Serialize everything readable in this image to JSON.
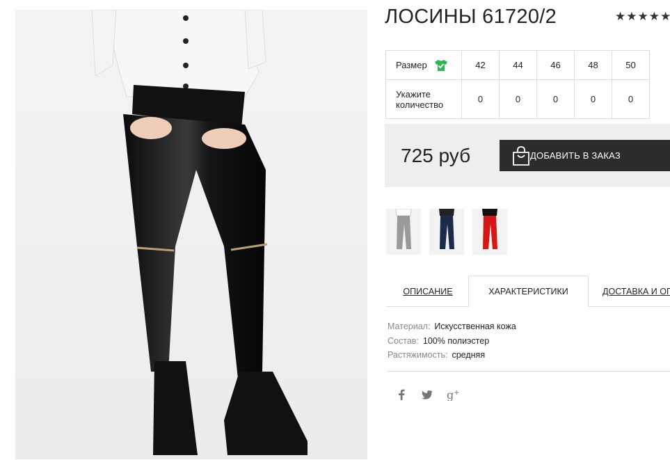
{
  "product": {
    "title": "ЛОСИНЫ 61720/2",
    "rating_stars": "★★★★★",
    "price": "725 руб",
    "add_to_cart_label": "ДОБАВИТЬ В ЗАКАЗ"
  },
  "size_table": {
    "size_label": "Размер",
    "quantity_label_line1": "Укажите",
    "quantity_label_line2": "количество",
    "sizes": [
      "42",
      "44",
      "46",
      "48",
      "50"
    ],
    "quantities": [
      "0",
      "0",
      "0",
      "0",
      "0"
    ]
  },
  "tabs": [
    {
      "label": "ОПИСАНИЕ"
    },
    {
      "label": "ХАРАКТЕРИСТИКИ"
    },
    {
      "label": "ДОСТАВКА И ОП"
    }
  ],
  "characteristics": [
    {
      "key": "Материал:",
      "value": "Искусственная кожа"
    },
    {
      "key": "Состав:",
      "value": "100% полиэстер"
    },
    {
      "key": "Растяжимость:",
      "value": "средняя"
    }
  ],
  "colors": {
    "price_bg": "#eeeeee",
    "button_bg": "#2c2c2c",
    "size_icon": "#2db84d"
  },
  "icons": [
    "tshirt-check-icon",
    "shopping-bag-icon",
    "facebook-icon",
    "twitter-icon",
    "google-plus-icon"
  ]
}
